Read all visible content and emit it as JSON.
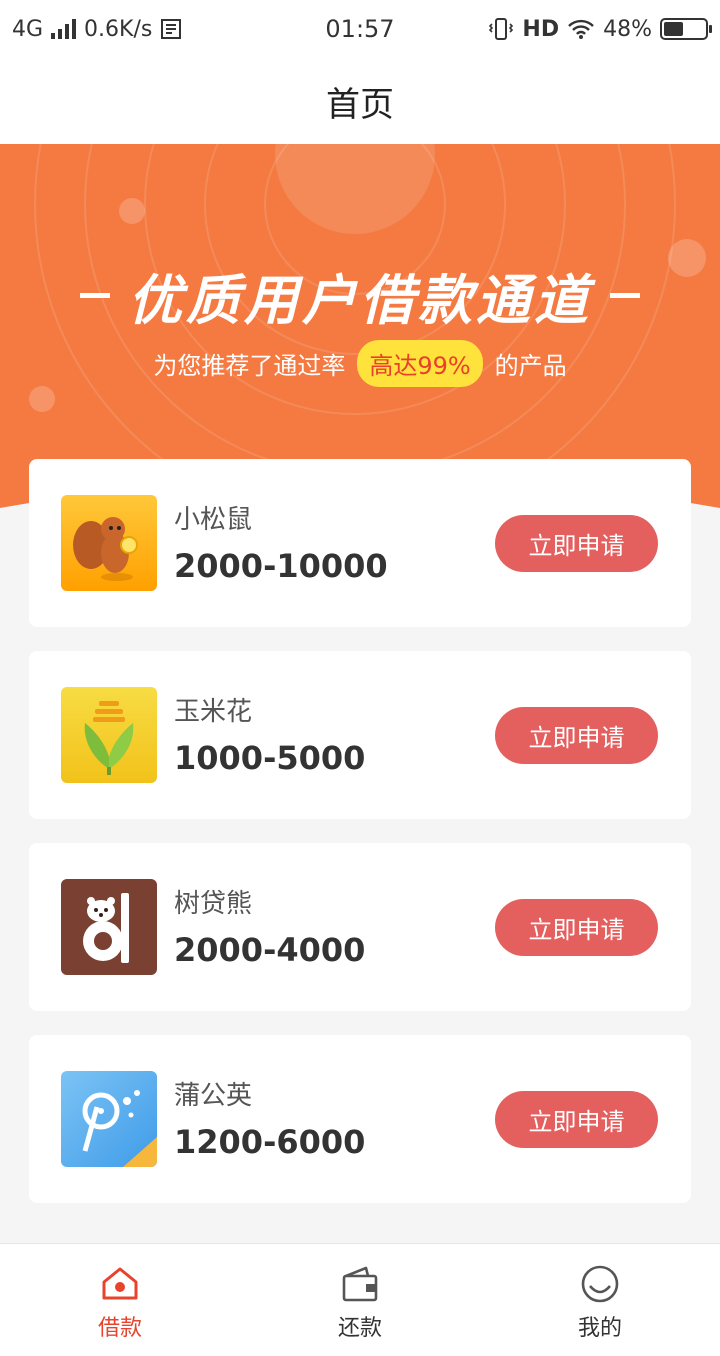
{
  "status_bar": {
    "network": "4G",
    "speed": "0.6K/s",
    "time": "01:57",
    "hd": "HD",
    "battery": "48%",
    "battery_level": 0.48
  },
  "header": {
    "title": "首页"
  },
  "banner": {
    "title": "优质用户借款通道",
    "subtitle_before": "为您推荐了通过率",
    "highlight": "高达99%",
    "subtitle_after": "的产品"
  },
  "products": [
    {
      "name": "小松鼠",
      "range": "2000-10000",
      "button": "立即申请",
      "icon": "squirrel-icon"
    },
    {
      "name": "玉米花",
      "range": "1000-5000",
      "button": "立即申请",
      "icon": "corn-icon"
    },
    {
      "name": "树贷熊",
      "range": "2000-4000",
      "button": "立即申请",
      "icon": "bear-icon"
    },
    {
      "name": "蒲公英",
      "range": "1200-6000",
      "button": "立即申请",
      "icon": "dandelion-icon"
    }
  ],
  "tabs": [
    {
      "label": "借款",
      "icon": "home-icon",
      "active": true
    },
    {
      "label": "还款",
      "icon": "wallet-icon",
      "active": false
    },
    {
      "label": "我的",
      "icon": "smile-icon",
      "active": false
    }
  ],
  "colors": {
    "banner": "#f47a42",
    "button": "#e4605f",
    "active_tab": "#e8442d",
    "highlight_bg": "#ffe23c"
  }
}
